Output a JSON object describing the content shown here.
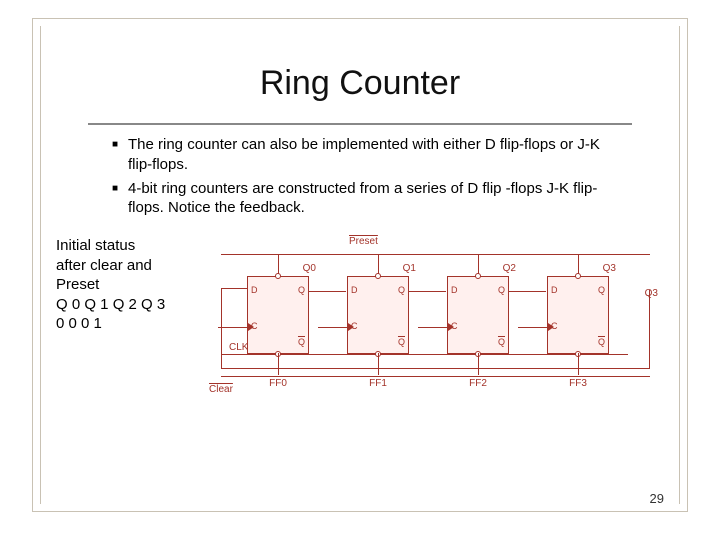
{
  "title": "Ring Counter",
  "bullets": [
    "The ring counter can also be implemented with either D flip-flops or J-K flip-flops.",
    "4-bit ring counters are constructed from a series of D flip -flops J-K flip-flops. Notice the feedback."
  ],
  "status": {
    "line1": "Initial status",
    "line2": "after clear and",
    "line3": "Preset",
    "header": "Q 0 Q 1 Q 2 Q 3",
    "values": " 0   0   0   1"
  },
  "diagram": {
    "preset": "Preset",
    "clear": "Clear",
    "clk": "CLK",
    "d": "D",
    "q": "Q",
    "qb": "Q",
    "c": "C",
    "outputs": [
      "Q0",
      "Q1",
      "Q2",
      "Q3"
    ],
    "names": [
      "FF0",
      "FF1",
      "FF2",
      "FF3"
    ]
  },
  "page": "29"
}
